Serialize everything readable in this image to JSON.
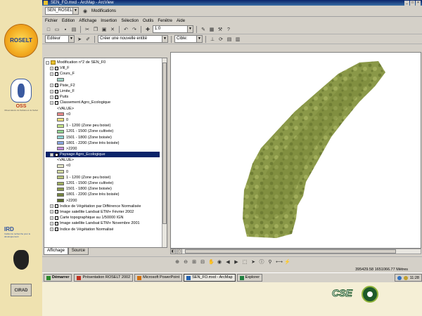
{
  "brand": {
    "roselt": "ROSELT",
    "oss": "OSS",
    "oss_sub": "Observatoire du Sahara et du Sahel",
    "ird": "IRD",
    "ird_sub": "Institut de recherche pour le développement",
    "cirad": "CIRAD",
    "cse": "CSE"
  },
  "window": {
    "title": "SEN_FO.mxd - ArcMap - ArcView",
    "controls": [
      "_",
      "□",
      "×"
    ]
  },
  "tab_row": {
    "document": "SEN_ROSELT",
    "status": "Modifications"
  },
  "menu": [
    "Fichier",
    "Edition",
    "Affichage",
    "Insertion",
    "Sélection",
    "Outils",
    "Fenêtre",
    "Aide"
  ],
  "toolbar": {
    "scale": "1:0",
    "editor": "Editeur",
    "task": "Créer une nouvelle entité",
    "target": "Cible:"
  },
  "toc": {
    "root": "Modification n°2 de SEN_F0",
    "rows": [
      {
        "type": "layer",
        "label": "Vill_F"
      },
      {
        "type": "layer",
        "label": "Cours_F"
      },
      {
        "type": "legend",
        "label": "",
        "color": "#9fd3c4"
      },
      {
        "type": "layer",
        "label": "Piste_F2"
      },
      {
        "type": "layer",
        "label": "Limite_F"
      },
      {
        "type": "layer",
        "label": "Puits"
      },
      {
        "type": "layer",
        "label": "Classement Agro_Ecologique"
      },
      {
        "type": "legend",
        "label": "<VALUE>",
        "color": ""
      },
      {
        "type": "legend",
        "label": "<0",
        "color": "#e88a8a"
      },
      {
        "type": "legend",
        "label": "0",
        "color": "#f4e07a"
      },
      {
        "type": "legend",
        "label": "1 - 1200    (Zone peu boisé)",
        "color": "#c7e68a"
      },
      {
        "type": "legend",
        "label": "1201 - 1500    (Zone cultivée)",
        "color": "#8fd48f"
      },
      {
        "type": "legend",
        "label": "1501 - 1800    (Zone boisée)",
        "color": "#8fd3d3"
      },
      {
        "type": "legend",
        "label": "1801 - 2200    (Zone très boisée)",
        "color": "#8aa8e6"
      },
      {
        "type": "legend",
        "label": ">2200",
        "color": "#c08ad8"
      },
      {
        "type": "selected",
        "label": "Paysage Agro_Ecologique"
      },
      {
        "type": "legend",
        "label": "<VALUE>",
        "color": ""
      },
      {
        "type": "legend",
        "label": "<0",
        "color": "#e6e8c8"
      },
      {
        "type": "legend",
        "label": "0",
        "color": "#d2dba0"
      },
      {
        "type": "legend",
        "label": "1 - 1200    (Zone peu boisé)",
        "color": "#b8c47a"
      },
      {
        "type": "legend",
        "label": "1201 - 1500    (Zone cultivée)",
        "color": "#a0ae60"
      },
      {
        "type": "legend",
        "label": "1501 - 1800    (Zone boisée)",
        "color": "#8a9a4c"
      },
      {
        "type": "legend",
        "label": "1801 - 2200    (Zone très boisée)",
        "color": "#76863e"
      },
      {
        "type": "legend",
        "label": ">2200",
        "color": "#5e6e2e"
      },
      {
        "type": "layer",
        "label": "Indice de Végétation par Différence Normalisée"
      },
      {
        "type": "layer",
        "label": "Image satellite Landsat ETM+ Février 2002"
      },
      {
        "type": "layer",
        "label": "Carte topographique au 1/50000 IGN"
      },
      {
        "type": "layer",
        "label": "Image satellite Landsat ETM+ Novembre 2001"
      },
      {
        "type": "layer",
        "label": "Indice de Végétation Normalisé"
      }
    ],
    "tabs": [
      "Affichage",
      "Source"
    ]
  },
  "map": {
    "fill_dark": "#6f7d35",
    "fill_mid": "#8a9848",
    "fill_light": "#a2ae5c"
  },
  "status_bar": {
    "coordinates": "395429.58   1651066.77 Mètres"
  },
  "taskbar": {
    "start": "Démarrer",
    "tasks": [
      {
        "label": "Présentation ROSELT 2002",
        "color": "#c03020",
        "active": false
      },
      {
        "label": "Microsoft PowerPoint",
        "color": "#d07010",
        "active": false
      },
      {
        "label": "SEN_FO.mxd - ArcMap",
        "color": "#2060b0",
        "active": true
      },
      {
        "label": "Explorer",
        "color": "#208040",
        "active": false
      }
    ],
    "clock": "11:28"
  }
}
